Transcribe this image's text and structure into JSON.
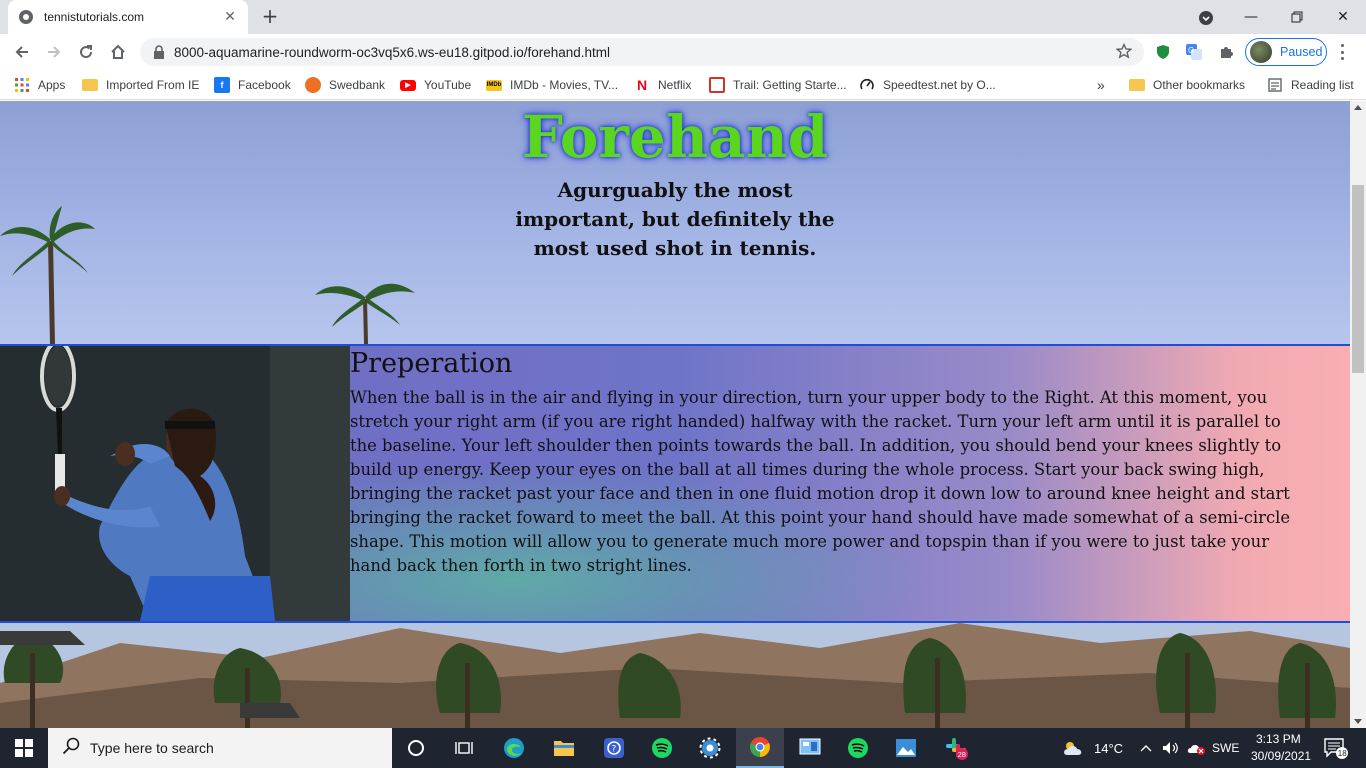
{
  "browser": {
    "tab_title": "tennistutorials.com",
    "url": "8000-aquamarine-roundworm-oc3vq5x6.ws-eu18.gitpod.io/forehand.html",
    "profile_status": "Paused",
    "bookmarks": [
      {
        "label": "Apps",
        "icon": "apps-grid-icon",
        "color": "#4285f4"
      },
      {
        "label": "Imported From IE",
        "icon": "folder-icon",
        "color": "#f6c64e"
      },
      {
        "label": "Facebook",
        "icon": "facebook-icon",
        "color": "#1877f2"
      },
      {
        "label": "Swedbank",
        "icon": "swedbank-icon",
        "color": "#ee7023"
      },
      {
        "label": "YouTube",
        "icon": "youtube-icon",
        "color": "#ff0000"
      },
      {
        "label": "IMDb - Movies, TV...",
        "icon": "imdb-icon",
        "color": "#f5c518"
      },
      {
        "label": "Netflix",
        "icon": "netflix-icon",
        "color": "#e50914"
      },
      {
        "label": "Trail: Getting Starte...",
        "icon": "trail-icon",
        "color": "#d93025"
      },
      {
        "label": "Speedtest.net by O...",
        "icon": "speedtest-icon",
        "color": "#202124"
      }
    ],
    "overflow": "»",
    "other_bookmarks": "Other bookmarks",
    "reading_list": "Reading list"
  },
  "page": {
    "title": "Forehand",
    "subtitle": "Agurguably the most important, but definitely the most used shot in tennis.",
    "section": {
      "heading": "Preperation",
      "body": "When the ball is in the air and flying in your direction, turn your upper body to the Right. At this moment, you stretch your right arm (if you are right handed) halfway with the racket. Turn your left arm until it is parallel to the baseline. Your left shoulder then points towards the ball. In addition, you should bend your knees slightly to build up energy. Keep your eyes on the ball at all times during the whole process. Start your back swing high, bringing the racket past your face and then in one fluid motion drop it down low to around knee height and start bringing the racket foward to meet the ball. At this point your hand should have made somewhat of a semi-circle shape. This motion will allow you to generate much more power and topspin than if you were to just take your hand back then forth in two stright lines."
    }
  },
  "taskbar": {
    "search_placeholder": "Type here to search",
    "weather": "14°C",
    "language": "SWE",
    "time": "3:13 PM",
    "date": "30/09/2021",
    "notification_count": "18",
    "slack_badge": "28"
  }
}
